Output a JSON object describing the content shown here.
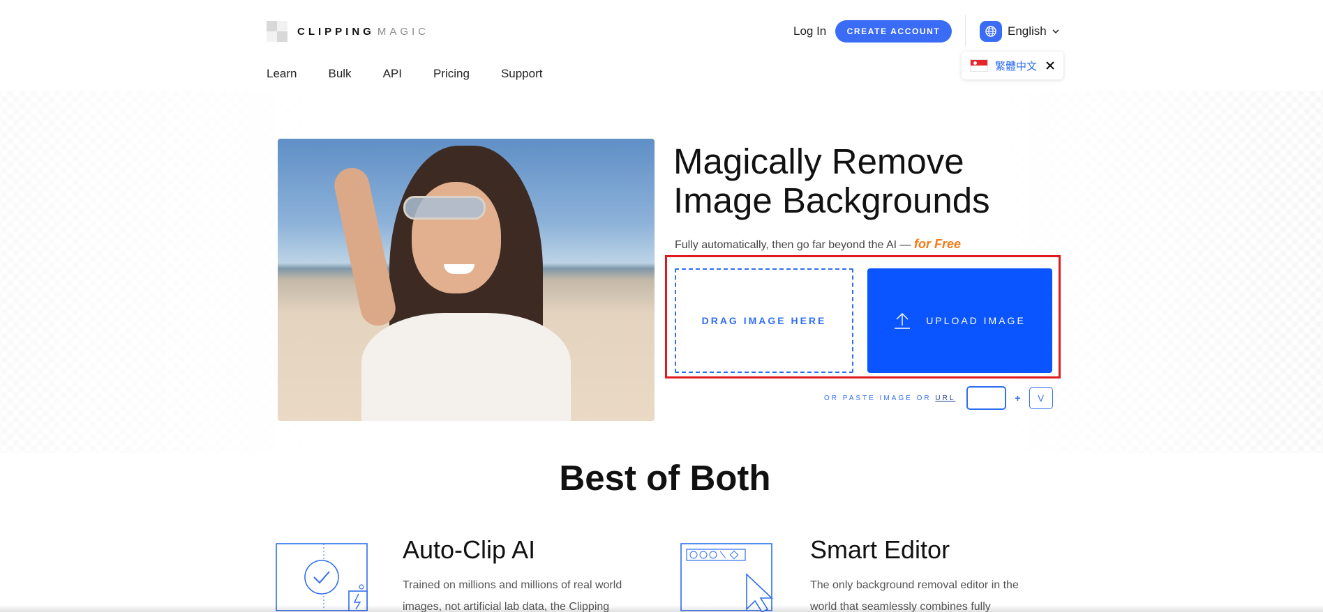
{
  "header": {
    "logo_word1": "CLIPPING",
    "logo_word2": "MAGIC",
    "login_label": "Log In",
    "create_account_label": "CREATE ACCOUNT",
    "language_label": "English",
    "language_alt": "繁體中文"
  },
  "nav": {
    "items": [
      {
        "label": "Learn"
      },
      {
        "label": "Bulk"
      },
      {
        "label": "API"
      },
      {
        "label": "Pricing"
      },
      {
        "label": "Support"
      }
    ]
  },
  "hero": {
    "title": "Magically Remove Image Backgrounds",
    "subtitle": "Fully automatically, then go far beyond the AI —",
    "subtitle_emphasis": "for Free",
    "drag_label": "DRAG IMAGE HERE",
    "upload_label": "UPLOAD IMAGE",
    "paste_prefix": "OR PASTE IMAGE OR",
    "paste_url": "URL",
    "key_plus": "+",
    "key_v": "V"
  },
  "features": {
    "section_title": "Best of Both",
    "items": [
      {
        "title": "Auto-Clip AI",
        "text": "Trained on millions and millions of real world images, not artificial lab data, the Clipping"
      },
      {
        "title": "Smart Editor",
        "text": "The only background removal editor in the world that seamlessly combines fully"
      }
    ]
  },
  "colors": {
    "accent": "#3b6cf6",
    "upload_blue": "#0a55ff",
    "highlight_orange": "#f07d1a",
    "frame_red": "#e0191f"
  },
  "icons": [
    "globe-icon",
    "chevron-down-icon",
    "close-icon",
    "upload-arrow-icon",
    "checkmark-icon",
    "editor-cursor-icon"
  ]
}
